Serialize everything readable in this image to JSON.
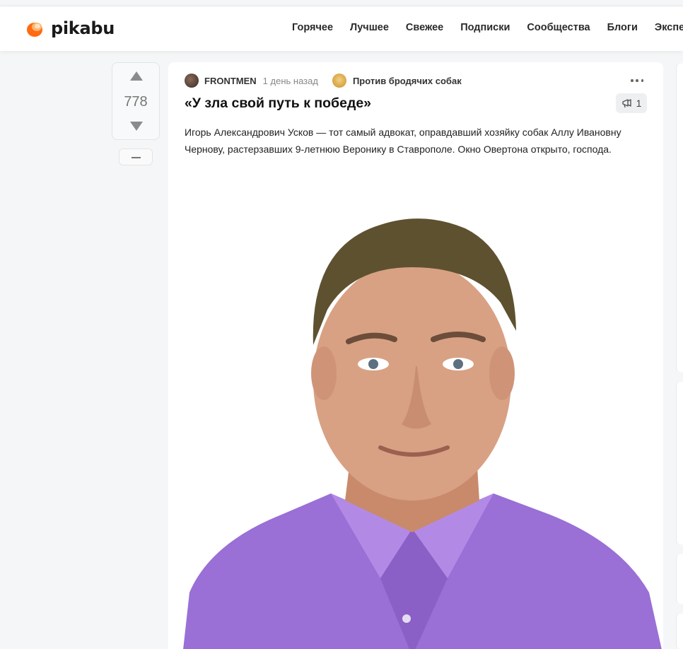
{
  "brand": {
    "name": "pikabu",
    "accent": "#ff6a13"
  },
  "nav": {
    "items": [
      {
        "label": "Горячее"
      },
      {
        "label": "Лучшее"
      },
      {
        "label": "Свежее"
      },
      {
        "label": "Подписки"
      },
      {
        "label": "Сообщества"
      },
      {
        "label": "Блоги"
      },
      {
        "label": "Эксперты"
      }
    ]
  },
  "story": {
    "rating": "778",
    "author": "FRONTMEN",
    "time": "1 день назад",
    "community": "Против бродячих собак",
    "title": "«У зла свой путь к победе»",
    "comments_count": "1",
    "text": "Игорь Александрович Усков — тот самый адвокат, оправдавший хозяйку собак Аллу Ивановну Чернову, растерзавших 9-летнюю Веронику в Ставрополе. Окно Овертона открыто, господа."
  },
  "colors": {
    "shirt": "#9a6fd6",
    "hair": "#5e5130",
    "skin": "#d8a183"
  }
}
